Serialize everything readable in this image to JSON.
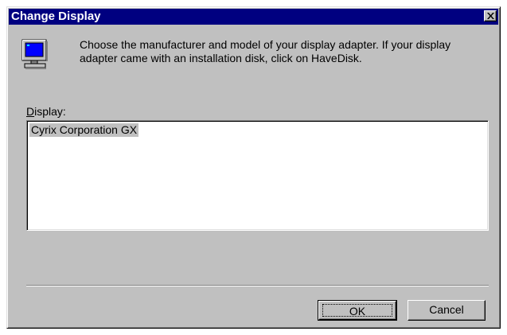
{
  "window": {
    "title": "Change Display",
    "colors": {
      "titlebar": "#000080",
      "face": "#c0c0c0",
      "selection": "#c0c0c0"
    }
  },
  "header": {
    "icon": "monitor-icon",
    "description": "Choose the manufacturer and model of your display adapter.  If your display adapter came with an installation disk, click on HaveDisk."
  },
  "display": {
    "label_accel": "D",
    "label_rest": "isplay:",
    "items": [
      {
        "label": "Cyrix Corporation GX",
        "selected": true
      }
    ]
  },
  "buttons": {
    "ok_label": "OK",
    "cancel_label": "Cancel"
  }
}
